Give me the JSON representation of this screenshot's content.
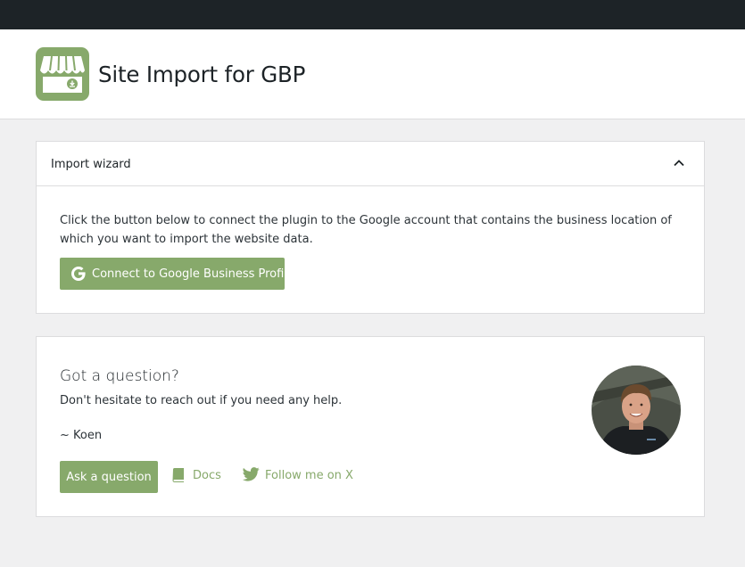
{
  "header": {
    "title": "Site Import for GBP",
    "logo_icon": "storefront-download-icon"
  },
  "wizard": {
    "title": "Import wizard",
    "toggle_icon": "chevron-up-icon",
    "description": "Click the button below to connect the plugin to the Google account that contains the business location of which you want to import the website data.",
    "connect_button": {
      "label": "Connect to Google Business Profile",
      "icon": "google-g-icon"
    }
  },
  "help": {
    "title": "Got a question?",
    "subtitle": "Don't hesitate to reach out if you need any help.",
    "signature": "~ Koen",
    "ask_button": "Ask a question",
    "docs_link": "Docs",
    "docs_icon": "book-icon",
    "follow_link": "Follow me on X",
    "follow_icon": "twitter-bird-icon",
    "avatar_icon": "author-avatar"
  },
  "colors": {
    "brand_green": "#87a96b",
    "admin_bar": "#1d2327",
    "background": "#f0f0f1"
  }
}
